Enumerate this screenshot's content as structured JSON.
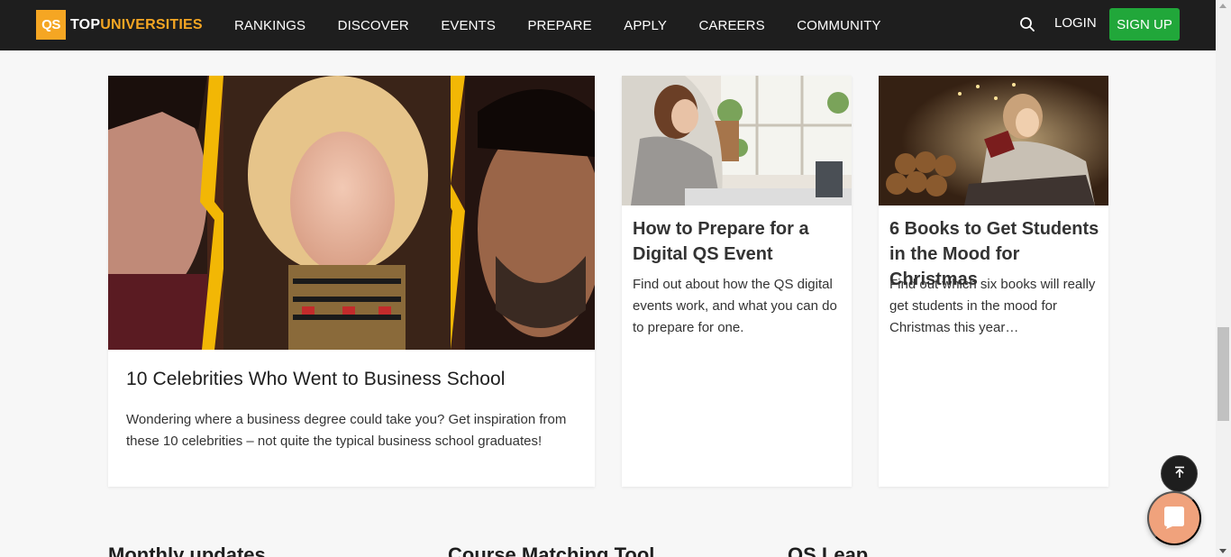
{
  "nav": {
    "logo_badge": "QS",
    "logo_top": "TOP",
    "logo_universities": "UNIVERSITIES",
    "menu": [
      "RANKINGS",
      "DISCOVER",
      "EVENTS",
      "PREPARE",
      "APPLY",
      "CAREERS",
      "COMMUNITY"
    ],
    "login": "LOGIN",
    "signup": "SIGN UP",
    "search_icon": "search-icon",
    "colors": {
      "bar": "#1e1e1e",
      "accent": "#f5a623",
      "signup": "#21a73a"
    }
  },
  "articles": [
    {
      "title": "10 Celebrities Who Went to Business School",
      "description": "Wondering where a business degree could take you? Get inspiration from these 10 celebrities – not quite the typical business school graduates!"
    },
    {
      "title": "How to Prepare for a Digital QS Event",
      "description": "Find out about how the QS digital events work, and what you can do to prepare for one."
    },
    {
      "title": "6 Books to Get Students in the Mood for Christmas",
      "description": "Find out which six books will really get students in the mood for Christmas this year…"
    }
  ],
  "sections": [
    "Monthly updates",
    "Course Matching Tool",
    "QS Leap"
  ],
  "floating": {
    "back_to_top_icon": "arrow-up-icon",
    "chat_icon": "chat-icon"
  }
}
